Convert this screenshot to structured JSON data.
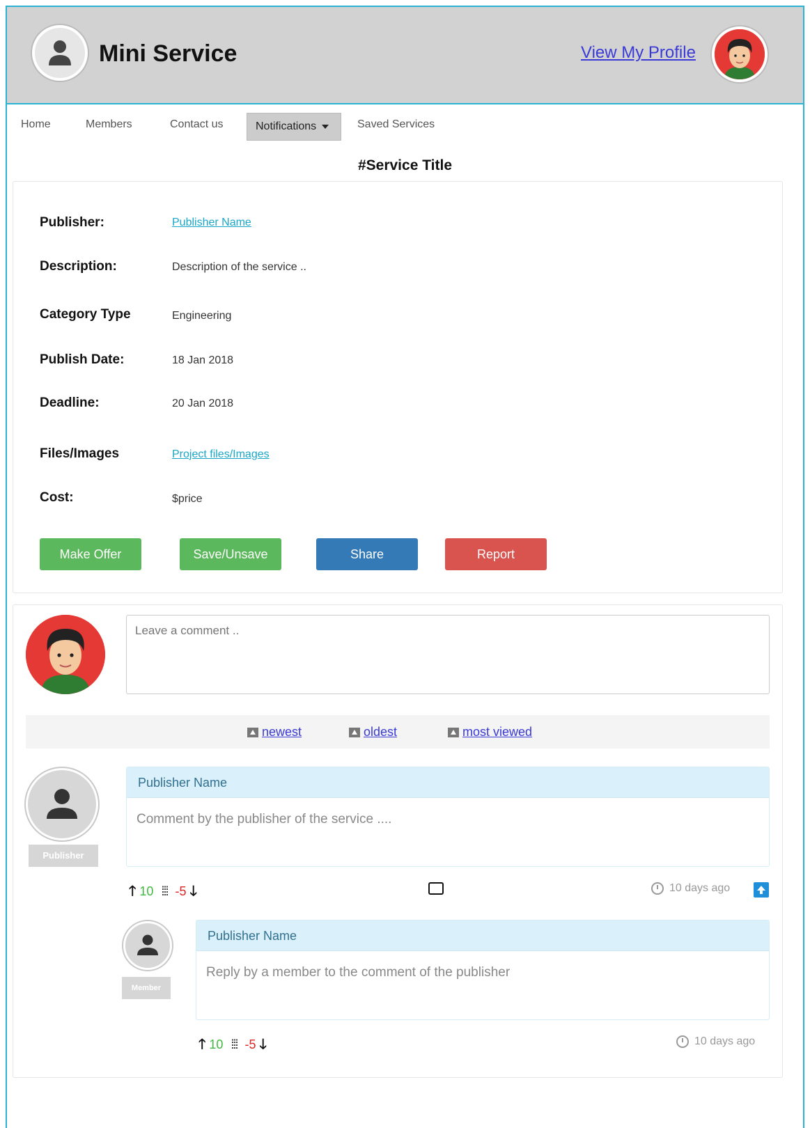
{
  "header": {
    "app_title": "Mini Service",
    "profile_link": "View My Profile"
  },
  "nav": {
    "items": [
      "Home",
      "Members",
      "Contact us",
      "Notifications",
      "Saved Services"
    ],
    "active": "Notifications"
  },
  "service": {
    "title": "#Service Title",
    "rows": [
      {
        "label": "Publisher:",
        "value": "Publisher Name"
      },
      {
        "label": "Description:",
        "value": "Description of the service .."
      },
      {
        "label": "Category Type",
        "value": "Engineering"
      },
      {
        "label": "Publish Date:",
        "value": "18 Jan 2018"
      },
      {
        "label": "Deadline:",
        "value": "20 Jan 2018"
      },
      {
        "label": "Files/Images",
        "value": "Project files/Images"
      },
      {
        "label": "Cost:",
        "value": "$price"
      }
    ],
    "buttons": {
      "make_offer": "Make Offer",
      "save": "Save/Unsave",
      "share": "Share",
      "report": "Report"
    }
  },
  "comments": {
    "placeholder": "Leave a comment ..",
    "sort": [
      "newest",
      "oldest",
      "most viewed"
    ],
    "thread": {
      "author": "Publisher Name",
      "role": "Publisher",
      "text": "Comment by the publisher of the service ....",
      "upvotes": "10",
      "downvotes": "-5",
      "time": "10 days ago",
      "reply": {
        "author": "Publisher Name",
        "role": "Member",
        "text": "Reply by a member to the comment of the publisher",
        "upvotes": "10",
        "downvotes": "-5",
        "time": "10 days ago"
      }
    }
  },
  "colors": {
    "accent": "#2bb3d6",
    "success": "#5cb85c",
    "primary": "#337ab7",
    "danger": "#d9534f"
  }
}
